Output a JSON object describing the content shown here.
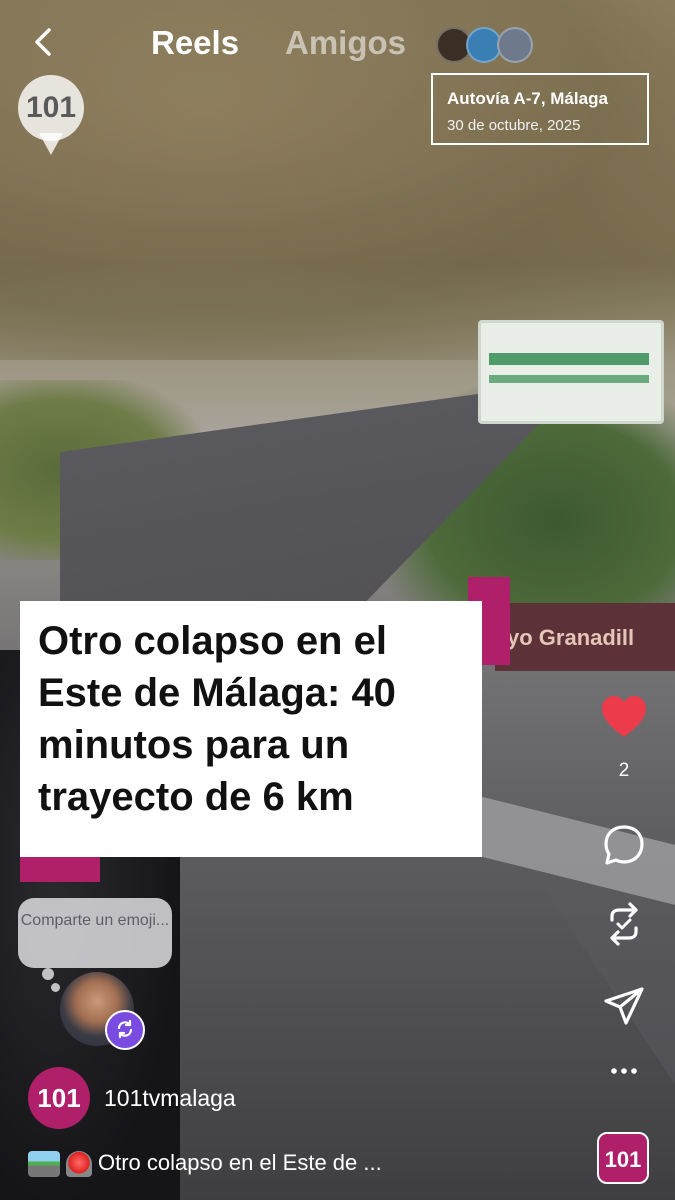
{
  "topbar": {
    "back_icon": "chevron-left-icon",
    "tabs": [
      {
        "label": "Reels",
        "active": true
      },
      {
        "label": "Amigos",
        "active": false
      }
    ]
  },
  "overlay": {
    "logo_text": "101",
    "location_title": "Autovía A-7, Málaga",
    "location_date": "30 de octubre, 2025",
    "headline": "Otro colapso en el Este de Málaga: 40 minutos para un trayecto de 6 km",
    "road_sign_text": "yo Granadill"
  },
  "actions": {
    "like_icon": "heart-filled-icon",
    "like_count": "2",
    "comment_icon": "comment-icon",
    "remix_icon": "repost-icon",
    "share_icon": "send-icon",
    "more_icon": "more-icon",
    "accent_color": "#ec3b4b"
  },
  "emoji_prompt": "Comparte un emoji...",
  "account": {
    "logo_text": "101",
    "username": "101tvmalaga",
    "brand_color": "#b01f6a"
  },
  "caption": "Otro colapso en el Este de ...",
  "audio_logo_text": "101"
}
